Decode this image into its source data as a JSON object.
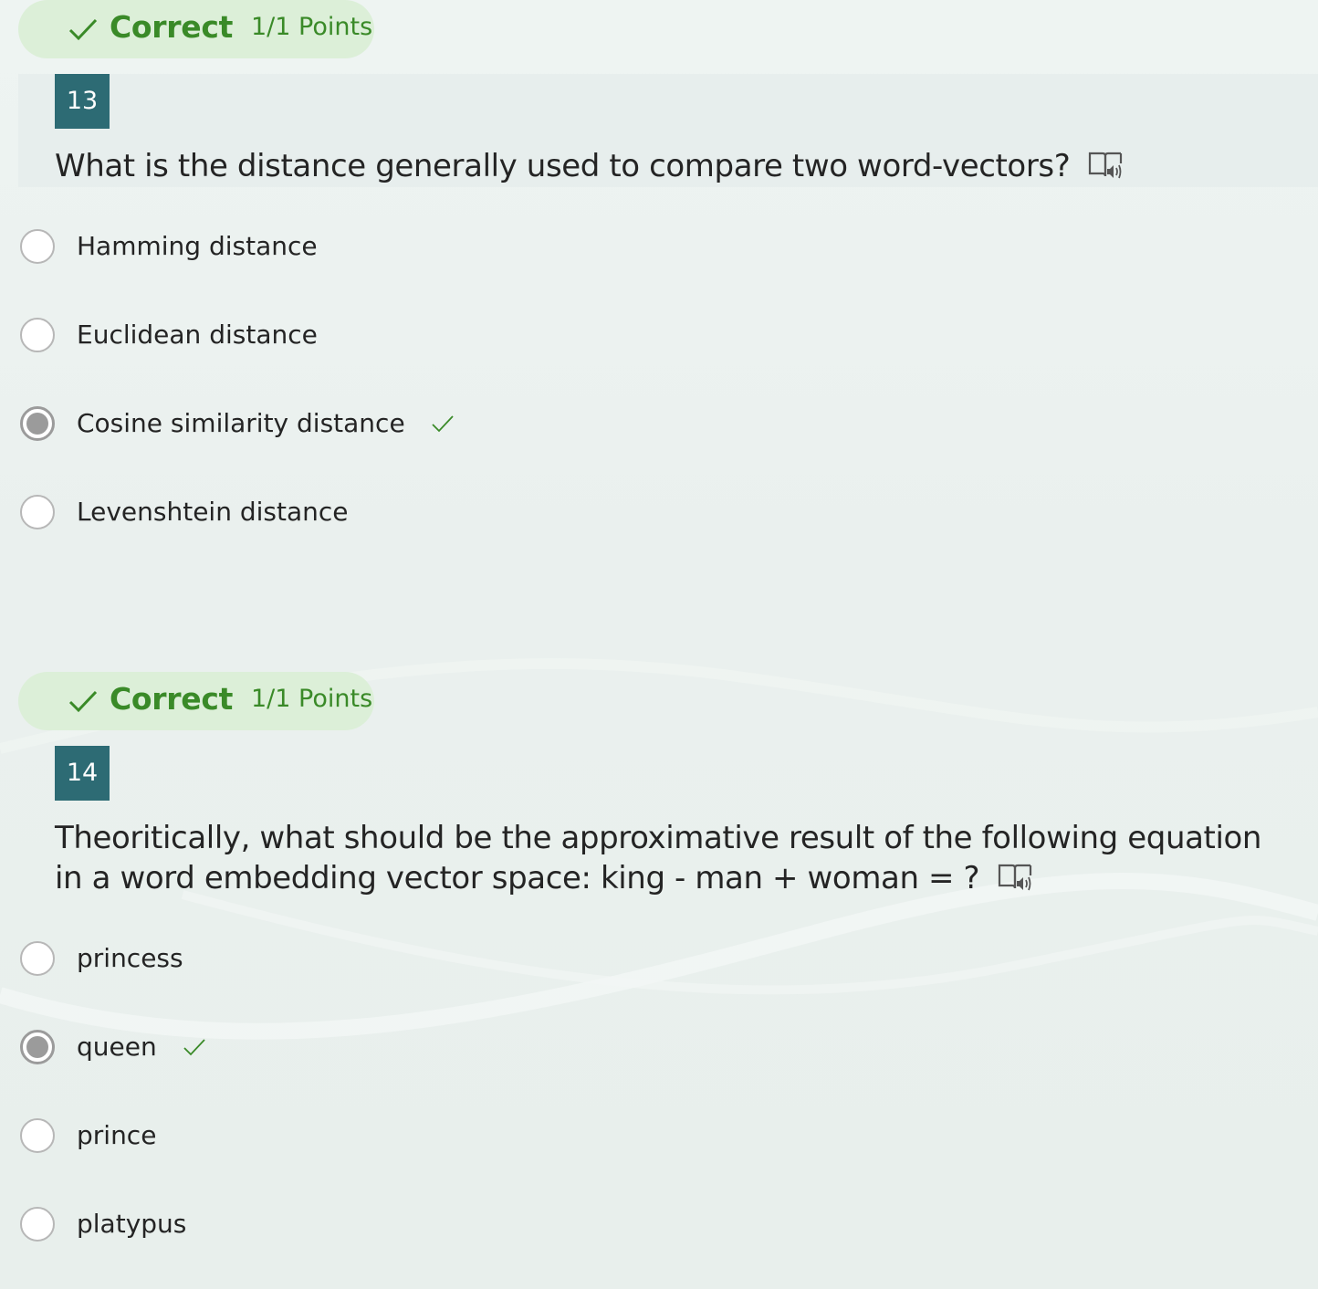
{
  "colors": {
    "correct_green": "#3a8a28",
    "pill_bg": "#dcefd8",
    "number_badge": "#2d6b74",
    "radio_selected": "#9b9b9b"
  },
  "questions": [
    {
      "result": {
        "label": "Correct",
        "points": "1/1 Points",
        "icon": "check-icon"
      },
      "number": "13",
      "text": "What is the distance generally used to compare two word-vectors?",
      "reader_icon": "immersive-reader-icon",
      "options": [
        {
          "label": "Hamming distance",
          "selected": false,
          "correct": false
        },
        {
          "label": "Euclidean distance",
          "selected": false,
          "correct": false
        },
        {
          "label": "Cosine similarity distance",
          "selected": true,
          "correct": true
        },
        {
          "label": "Levenshtein distance",
          "selected": false,
          "correct": false
        }
      ]
    },
    {
      "result": {
        "label": "Correct",
        "points": "1/1 Points",
        "icon": "check-icon"
      },
      "number": "14",
      "text": "Theoritically, what should be the approximative result of the following equation in a word embedding vector space: king - man + woman = ?",
      "reader_icon": "immersive-reader-icon",
      "options": [
        {
          "label": "princess",
          "selected": false,
          "correct": false
        },
        {
          "label": "queen",
          "selected": true,
          "correct": true
        },
        {
          "label": "prince",
          "selected": false,
          "correct": false
        },
        {
          "label": "platypus",
          "selected": false,
          "correct": false
        }
      ]
    }
  ]
}
